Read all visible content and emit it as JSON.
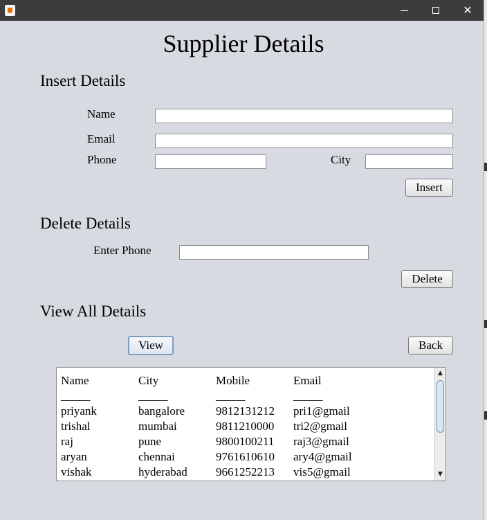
{
  "window": {
    "icon": "java-icon",
    "controls": {
      "minimize_icon": "minimize-icon",
      "maximize_icon": "maximize-icon",
      "close_icon": "close-icon",
      "close_glyph": "✕"
    }
  },
  "page": {
    "title": "Supplier Details"
  },
  "insert": {
    "heading": "Insert Details",
    "name_label": "Name",
    "name_value": "",
    "email_label": "Email",
    "email_value": "",
    "phone_label": "Phone",
    "phone_value": "",
    "city_label": "City",
    "city_value": "",
    "button": "Insert"
  },
  "delete": {
    "heading": "Delete Details",
    "phone_label": "Enter Phone",
    "phone_value": "",
    "button": "Delete"
  },
  "view": {
    "heading": "View All Details",
    "view_button": "View",
    "back_button": "Back"
  },
  "table": {
    "headers": [
      "Name",
      "City",
      "Mobile",
      "Email"
    ],
    "underline": "_____",
    "rows": [
      [
        "priyank",
        "bangalore",
        "9812131212",
        "pri1@gmail"
      ],
      [
        "trishal",
        "mumbai",
        "9811210000",
        "tri2@gmail"
      ],
      [
        "raj",
        "pune",
        "9800100211",
        "raj3@gmail"
      ],
      [
        "aryan",
        "chennai",
        "9761610610",
        "ary4@gmail"
      ],
      [
        "vishak",
        "hyderabad",
        "9661252213",
        "vis5@gmail"
      ]
    ],
    "scroll": {
      "up_icon": "▲",
      "down_icon": "▼"
    }
  }
}
